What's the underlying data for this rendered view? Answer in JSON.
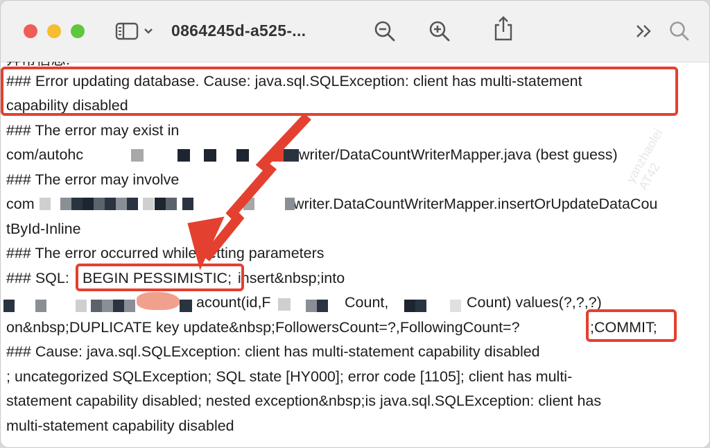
{
  "window": {
    "title": "0864245d-a525-...",
    "toolbar": {
      "sidebar_icon": "sidebar-icon",
      "chevron_icon": "chevron-down-icon",
      "zoom_out_icon": "zoom-out-icon",
      "zoom_in_icon": "zoom-in-icon",
      "share_icon": "share-icon",
      "more_icon": "double-chevron-icon",
      "search_icon": "search-icon"
    }
  },
  "log": {
    "cut_line": "异常信息:",
    "lines": [
      "### Error updating database.  Cause: java.sql.SQLException: client has multi-statement",
      "capability disabled",
      "### The error may exist in",
      "com/autohc",
      "writer/DataCountWriterMapper.java (best guess)",
      "### The error may involve",
      "com",
      "writer.DataCountWriterMapper.insertOrUpdateDataCou",
      "tById-Inline",
      "### The error occurred while setting parameters",
      "### SQL: ",
      "BEGIN PESSIMISTIC;",
      " insert&nbsp;into",
      "acount(id,F",
      "Count,",
      "Count) values(?,?,?)",
      "on&nbsp;DUPLICATE key update&nbsp;FollowersCount=?,FollowingCount=?",
      ";COMMIT;",
      "### Cause: java.sql.SQLException: client has multi-statement capability disabled",
      "; uncategorized SQLException; SQL state [HY000]; error code [1105]; client has multi-",
      "statement capability disabled; nested exception&nbsp;is java.sql.SQLException: client has",
      "multi-statement capability disabled"
    ]
  },
  "watermark": "yanzhaolei AT42",
  "colors": {
    "annotation": "#e4402f",
    "text": "#1d1d1d",
    "titlebar": "#f1f1f1"
  }
}
